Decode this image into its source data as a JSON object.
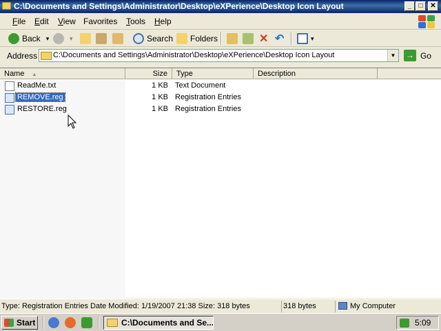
{
  "window": {
    "title": "C:\\Documents and Settings\\Administrator\\Desktop\\eXPerience\\Desktop Icon Layout",
    "controls": {
      "minimize": "_",
      "maximize": "□",
      "close": "✕"
    }
  },
  "menu": {
    "items": [
      {
        "label": "File",
        "u": "F",
        "rest": "ile"
      },
      {
        "label": "Edit",
        "u": "E",
        "rest": "dit"
      },
      {
        "label": "View",
        "u": "V",
        "rest": "iew"
      },
      {
        "label": "Favorites",
        "u": "",
        "rest": "Favorites"
      },
      {
        "label": "Tools",
        "u": "T",
        "rest": "ools"
      },
      {
        "label": "Help",
        "u": "H",
        "rest": "elp"
      }
    ]
  },
  "toolbar": {
    "back_label": "Back",
    "search_label": "Search",
    "folders_label": "Folders",
    "dropdown_glyph": "▾",
    "icons": {
      "back": "back-arrow-icon",
      "forward": "forward-arrow-icon",
      "up": "up-folder-icon",
      "search": "magnifier-icon",
      "folders": "folders-icon",
      "move_to": "move-to-icon",
      "copy_to": "copy-to-icon",
      "delete": "delete-x-icon",
      "undo": "undo-icon",
      "views": "views-icon"
    }
  },
  "address": {
    "label": "Address",
    "value": "C:\\Documents and Settings\\Administrator\\Desktop\\eXPerience\\Desktop Icon Layout",
    "dropdown_glyph": "▼",
    "go_label": "Go",
    "go_glyph": "→"
  },
  "columns": {
    "name": "Name",
    "sort_glyph": "▲",
    "size": "Size",
    "type": "Type",
    "description": "Description"
  },
  "files": [
    {
      "name": "ReadMe.txt",
      "size": "1 KB",
      "type": "Text Document",
      "selected": false,
      "icon": "text-file-icon"
    },
    {
      "name": "REMOVE.reg",
      "size": "1 KB",
      "type": "Registration Entries",
      "selected": true,
      "icon": "registry-file-icon"
    },
    {
      "name": "RESTORE.reg",
      "size": "1 KB",
      "type": "Registration Entries",
      "selected": false,
      "icon": "registry-file-icon"
    }
  ],
  "status": {
    "details": "Type: Registration Entries Date Modified: 1/19/2007 21:38 Size: 318 bytes",
    "size": "318 bytes",
    "zone": "My Computer"
  },
  "taskbar": {
    "start_label": "Start",
    "task_label": "C:\\Documents and Se...",
    "clock": "5:09"
  },
  "colors": {
    "titlebar": "#0a246a",
    "selection": "#316ac5",
    "go_green": "#3b9b2e"
  }
}
